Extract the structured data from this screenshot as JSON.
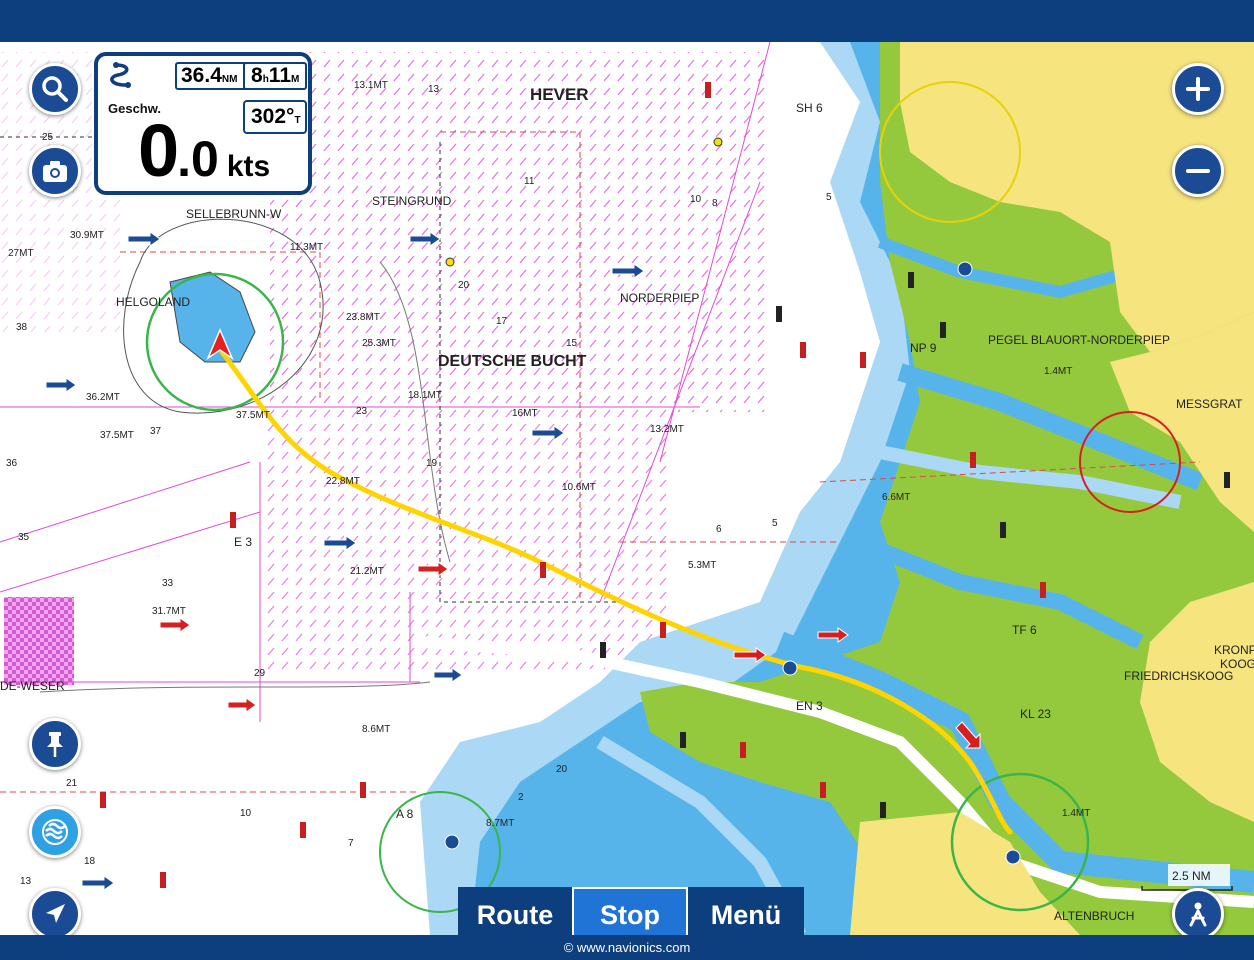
{
  "app": {
    "copyright": "© www.navionics.com"
  },
  "info_panel": {
    "distance_value": "36.4",
    "distance_unit": "NM",
    "time_hours": "8",
    "time_hours_unit": "h",
    "time_minutes": "11",
    "time_minutes_unit": "M",
    "speed_label": "Geschw.",
    "speed_int": "0",
    "speed_dec": ".0",
    "speed_unit": "kts",
    "course_value": "302°",
    "course_unit": "T"
  },
  "buttons": {
    "search_icon": "search-icon",
    "camera_icon": "camera-icon",
    "zoom_in_icon": "plus-icon",
    "zoom_out_icon": "minus-icon",
    "pin_icon": "pin-icon",
    "layers_icon": "layers-icon",
    "locate_icon": "navigation-arrow-icon",
    "profile_icon": "person-icon"
  },
  "tabs": [
    {
      "label": "Route",
      "active": false
    },
    {
      "label": "Stop",
      "active": true
    },
    {
      "label": "Menü",
      "active": false
    }
  ],
  "map": {
    "labels": {
      "hever": "HEVER",
      "steingrund": "STEINGRUND",
      "sellebrunn": "SELLEBRUNN-W",
      "helgoland": "HELGOLAND",
      "norderpiep": "NORDERPIEP",
      "deutsche_bucht": "DEUTSCHE BUCHT",
      "pegel": "PEGEL BLAUORT-NORDERPIEP",
      "messgrat": "MESSGRAT",
      "friedrichskoog": "FRIEDRICHSKOOG",
      "kronp": "KRONP",
      "koog": "KOOG",
      "altenbruch": "ALTENBRUCH",
      "de_weser": "DE-WESER",
      "sh6": "SH 6",
      "np9": "NP 9",
      "tf6": "TF 6",
      "kl23": "KL 23",
      "en3": "EN 3",
      "e3": "E 3",
      "a8": "A 8",
      "scale": "2.5 NM"
    },
    "depths": [
      {
        "t": "13.1MT"
      },
      {
        "t": "13"
      },
      {
        "t": "11"
      },
      {
        "t": "10"
      },
      {
        "t": "8"
      },
      {
        "t": "27MT"
      },
      {
        "t": "30.9MT"
      },
      {
        "t": "11.3MT"
      },
      {
        "t": "38"
      },
      {
        "t": "23.8MT"
      },
      {
        "t": "25.3MT"
      },
      {
        "t": "36.2MT"
      },
      {
        "t": "37.5MT"
      },
      {
        "t": "37"
      },
      {
        "t": "37.5MT"
      },
      {
        "t": "18.1MT"
      },
      {
        "t": "16MT"
      },
      {
        "t": "13.2MT"
      },
      {
        "t": "36"
      },
      {
        "t": "22.8MT"
      },
      {
        "t": "10.6MT"
      },
      {
        "t": "35"
      },
      {
        "t": "33"
      },
      {
        "t": "21.2MT"
      },
      {
        "t": "5.3MT"
      },
      {
        "t": "31.7MT"
      },
      {
        "t": "29"
      },
      {
        "t": "8.6MT"
      },
      {
        "t": "8.7MT"
      },
      {
        "t": "6.6MT"
      },
      {
        "t": "1.4MT"
      },
      {
        "t": "1.4MT"
      },
      {
        "t": "25"
      },
      {
        "t": "20"
      },
      {
        "t": "17"
      },
      {
        "t": "23"
      },
      {
        "t": "19"
      },
      {
        "t": "15"
      },
      {
        "t": "21"
      },
      {
        "t": "18"
      },
      {
        "t": "13"
      },
      {
        "t": "5"
      },
      {
        "t": "5"
      },
      {
        "t": "6"
      },
      {
        "t": "7"
      },
      {
        "t": "10"
      },
      {
        "t": "20"
      },
      {
        "t": "2"
      }
    ]
  },
  "colors": {
    "bar": "#0d3f7e",
    "button": "#1b4b94",
    "active_tab": "#1f74d6",
    "land": "#f6e47e",
    "drying": "#95c93d",
    "shallow": "#57b4ea",
    "mid": "#aad8f5",
    "route": "#ffd400"
  }
}
